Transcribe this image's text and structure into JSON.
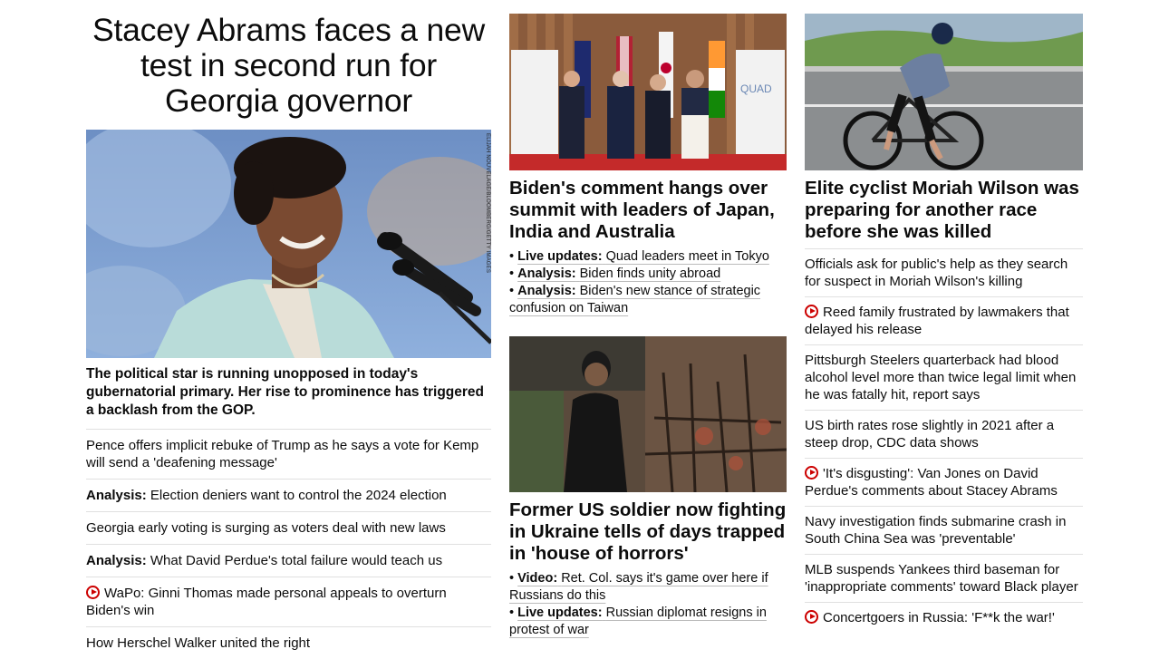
{
  "lead": {
    "title": "Stacey Abrams faces a new test in second run for Georgia governor",
    "image_alt": "Stacey Abrams speaking at a microphone",
    "photo_credit": "ELIJAH NOUVELAGE/BLOOMBERG/GETTY IMAGES",
    "description": "The political star is running unopposed in today's gubernatorial primary. Her rise to prominence has triggered a backlash from the GOP.",
    "links": [
      {
        "prefix": "",
        "text": "Pence offers implicit rebuke of Trump as he says a vote for Kemp will send a 'deafening message'",
        "video": false
      },
      {
        "prefix": "Analysis:",
        "text": "Election deniers want to control the 2024 election",
        "video": false
      },
      {
        "prefix": "",
        "text": "Georgia early voting is surging as voters deal with new laws",
        "video": false
      },
      {
        "prefix": "Analysis:",
        "text": "What David Perdue's total failure would teach us",
        "video": false
      },
      {
        "prefix": "",
        "text": "WaPo: Ginni Thomas made personal appeals to overturn Biden's win",
        "video": true
      },
      {
        "prefix": "",
        "text": "How Herschel Walker united the right",
        "video": false
      }
    ]
  },
  "quad": {
    "image_alt": "Quad leaders posing in front of flags",
    "headline": "Biden's comment hangs over summit with leaders of Japan, India and Australia",
    "bullets": [
      {
        "prefix": "Live updates:",
        "text": "Quad leaders meet in Tokyo"
      },
      {
        "prefix": "Analysis:",
        "text": "Biden finds unity abroad"
      },
      {
        "prefix": "Analysis:",
        "text": "Biden's new stance of strategic confusion on Taiwan"
      }
    ],
    "banner_text": "QUAD"
  },
  "ukraine": {
    "image_alt": "Man standing in burned-out building",
    "headline": "Former US soldier now fighting in Ukraine tells of days trapped in 'house of horrors'",
    "bullets": [
      {
        "prefix": "Video:",
        "text": "Ret. Col. says it's game over here if Russians do this"
      },
      {
        "prefix": "Live updates:",
        "text": "Russian diplomat resigns in protest of war"
      }
    ]
  },
  "cyclist": {
    "image_alt": "Cyclist riding on a mountain road",
    "headline": "Elite cyclist Moriah Wilson was preparing for another race before she was killed",
    "links": [
      {
        "text": "Officials ask for public's help as they search for suspect in Moriah Wilson's killing",
        "video": false
      },
      {
        "text": "Reed family frustrated by lawmakers that delayed his release",
        "video": true
      },
      {
        "text": "Pittsburgh Steelers quarterback had blood alcohol level more than twice legal limit when he was fatally hit, report says",
        "video": false
      },
      {
        "text": "US birth rates rose slightly in 2021 after a steep drop, CDC data shows",
        "video": false
      },
      {
        "text": "'It's disgusting': Van Jones on David Perdue's comments about Stacey Abrams",
        "video": true
      },
      {
        "text": "Navy investigation finds submarine crash in South China Sea was 'preventable'",
        "video": false
      },
      {
        "text": "MLB suspends Yankees third baseman for 'inappropriate comments' toward Black player",
        "video": false
      },
      {
        "text": "Concertgoers in Russia: 'F**k the war!'",
        "video": true
      }
    ]
  },
  "colors": {
    "video_red": "#cc0000",
    "divider": "#e0e0e0",
    "text": "#0c0c0c"
  }
}
